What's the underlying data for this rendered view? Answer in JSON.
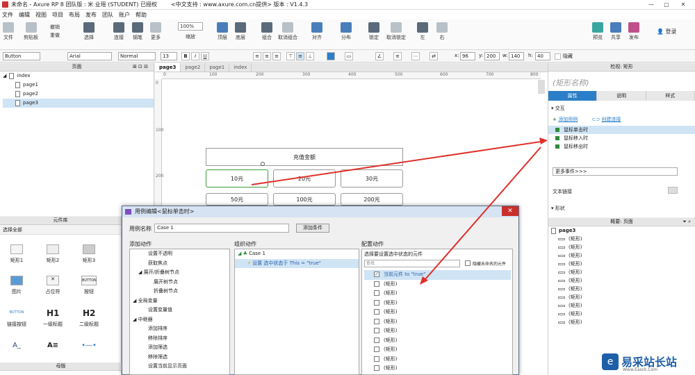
{
  "titlebar": {
    "title": "未命名 - Axure RP 8 团队版 : 米 业瑶 (STUDENT) 已授权",
    "support": "<中文支持 : www.axure.com.cn提供> 版本 : V1.4.3",
    "min": "—",
    "max": "▢",
    "close": "✕"
  },
  "menu": [
    "文件",
    "编辑",
    "视图",
    "项目",
    "布局",
    "发布",
    "团队",
    "账户",
    "帮助"
  ],
  "toolbar": {
    "file": "文件",
    "clipboard": "剪贴板",
    "undo": "撤销",
    "redo": "重做",
    "select": "选择",
    "connect": "连接",
    "pen": "钢笔",
    "more": "更多",
    "zoom_value": "100%",
    "zoom": "缩放",
    "top": "顶层",
    "bottom": "底层",
    "group": "组合",
    "ungroup": "取消组合",
    "align": "对齐",
    "distribute": "分布",
    "lock": "锁定",
    "unlock": "取消锁定",
    "left": "左",
    "right": "右",
    "preview": "预览",
    "share": "共享",
    "publish": "发布",
    "login": "登录"
  },
  "format": {
    "widget": "Button",
    "font": "Arial",
    "style": "Normal",
    "size": "13",
    "x_label": "x:",
    "x": "96",
    "y_label": "y:",
    "y": "200",
    "w_label": "w:",
    "w": "140",
    "h_label": "h:",
    "h": "40",
    "hidden": "隐藏",
    "bold": "B",
    "italic": "I",
    "underline": "U"
  },
  "pages_panel": {
    "title": "页面",
    "root": "index",
    "items": [
      "page1",
      "page2",
      "page3"
    ],
    "selected": "page3"
  },
  "library": {
    "title": "元件库",
    "selector": "选择全部",
    "items": [
      "矩形1",
      "矩形2",
      "矩形3",
      "图片",
      "占位符",
      "按钮",
      "链接按钮",
      "一级标题",
      "二级标题"
    ],
    "button_text": "BUTTON",
    "h1": "H1",
    "h2": "H2",
    "text_glyph": "A_"
  },
  "masters": {
    "title": "母版"
  },
  "canvas": {
    "tabs": [
      "page3",
      "page2",
      "page1",
      "index"
    ],
    "active_tab": "page3",
    "ruler_marks": [
      "0",
      "100",
      "200",
      "300",
      "400",
      "500",
      "600",
      "700",
      "800"
    ],
    "vruler_marks": [
      "0",
      "100",
      "200"
    ],
    "header_box": "充值金额",
    "row1": [
      "10元",
      "20元",
      "30元"
    ],
    "row2": [
      "50元",
      "100元",
      "200元"
    ]
  },
  "inspector": {
    "title": "检视: 矩形",
    "name_placeholder": "(矩形名称)",
    "tabs": [
      "属性",
      "说明",
      "样式"
    ],
    "section": "交互",
    "add_case": "添加用例",
    "create_link": "创建连接",
    "events": [
      "鼠标单击时",
      "鼠标移入时",
      "鼠标移出时"
    ],
    "more_events": "更多事件>>>",
    "text_link": "文本链接",
    "shape": "形状"
  },
  "outline": {
    "title": "概要: 页面",
    "page": "page3",
    "item": "(矩形)",
    "count": 11
  },
  "dialog": {
    "title": "用例编辑<鼠标单击时>",
    "case_label": "用例名称",
    "case_name": "Case 1",
    "add_condition": "添加条件",
    "col1": "添加动作",
    "col2": "组织动作",
    "col3": "配置动作",
    "actions": [
      {
        "t": "设置不透明",
        "lvl": 2
      },
      {
        "t": "获取焦点",
        "lvl": 2
      },
      {
        "t": "展开/折叠树节点",
        "lvl": 1
      },
      {
        "t": "展开树节点",
        "lvl": 3
      },
      {
        "t": "折叠树节点",
        "lvl": 3
      },
      {
        "t": "全局变量",
        "lvl": 0
      },
      {
        "t": "设置变量值",
        "lvl": 2
      },
      {
        "t": "中继器",
        "lvl": 0
      },
      {
        "t": "添加排序",
        "lvl": 2
      },
      {
        "t": "移除排序",
        "lvl": 2
      },
      {
        "t": "添加筛选",
        "lvl": 2
      },
      {
        "t": "移除筛选",
        "lvl": 2
      },
      {
        "t": "设置当前显示页面",
        "lvl": 2
      }
    ],
    "org_case": "Case 1",
    "org_action": "设置 选中状态于 This = \"true\"",
    "config_hint": "选择要设置选中状态的元件",
    "search_placeholder": "查找",
    "hide_unnamed": "隐藏未命名的元件",
    "checked_item": "当前元件 to \"true\"",
    "list_item": "(矩形)",
    "list_count": 10
  },
  "watermark": {
    "text": "易采站长站",
    "sub": "Www.Easck.Com"
  }
}
